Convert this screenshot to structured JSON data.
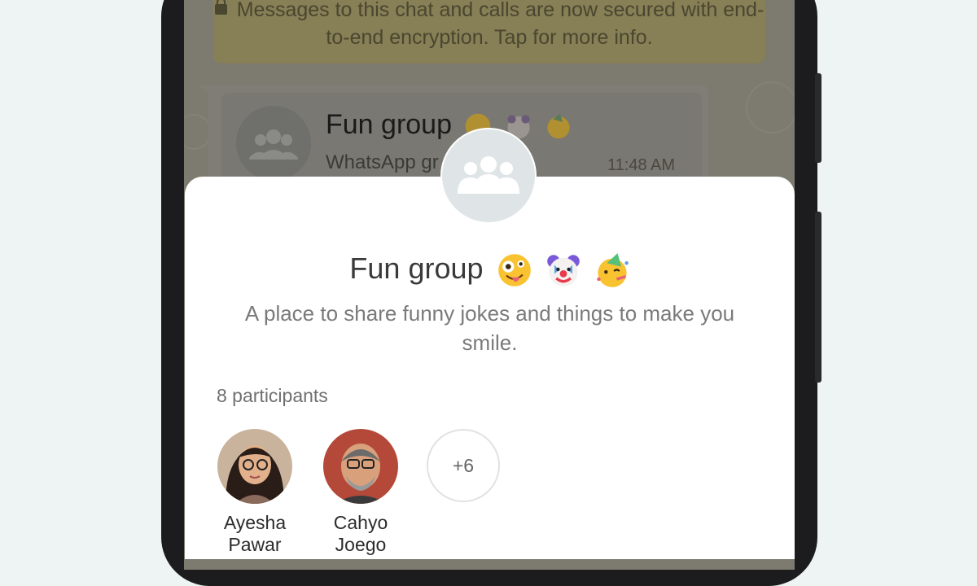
{
  "background_chat": {
    "encryption_notice": "Messages to this chat and calls are now secured with end-to-end encryption. Tap for more info.",
    "invite_title": "Fun group",
    "invite_subtitle": "WhatsApp gr",
    "time": "11:48 AM"
  },
  "sheet": {
    "group_name": "Fun group",
    "emojis": [
      "zany-face-icon",
      "clown-face-icon",
      "partying-face-icon"
    ],
    "description": "A place to share funny jokes and things to make you smile.",
    "participants_label": "8 participants",
    "participants": [
      {
        "name_line1": "Ayesha",
        "name_line2": "Pawar"
      },
      {
        "name_line1": "Cahyo",
        "name_line2": "Joego"
      }
    ],
    "more_count": "+6"
  },
  "colors": {
    "sheet_bg": "#ffffff",
    "group_icon_bg": "#dfe5e7",
    "chat_dim_bg": "#7d7a6f",
    "page_bg": "#eef4f4"
  }
}
